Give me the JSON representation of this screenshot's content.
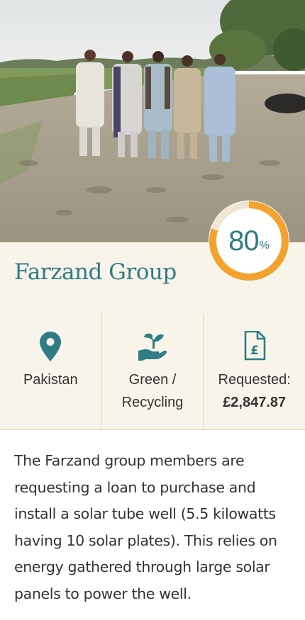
{
  "loan": {
    "title": "Farzand Group",
    "funded_percent": 80,
    "funded_percent_sign": "%"
  },
  "stats": {
    "country": "Pakistan",
    "sector_line1": "Green /",
    "sector_line2": "Recycling",
    "requested_label": "Requested:",
    "requested_amount": "£2,847.87"
  },
  "description": "The Farzand group members are requesting a loan to purchase and install a solar tube well (5.5 kilowatts having 10 solar plates). This relies on energy gathered through large solar panels to power the well.",
  "icons": {
    "country": "location-pin-icon",
    "sector": "hand-with-plant-icon",
    "requested": "pound-document-icon"
  },
  "colors": {
    "accent_teal": "#2e7d85",
    "progress_orange": "#f5a12e",
    "band_bg": "#f8f4ea"
  }
}
